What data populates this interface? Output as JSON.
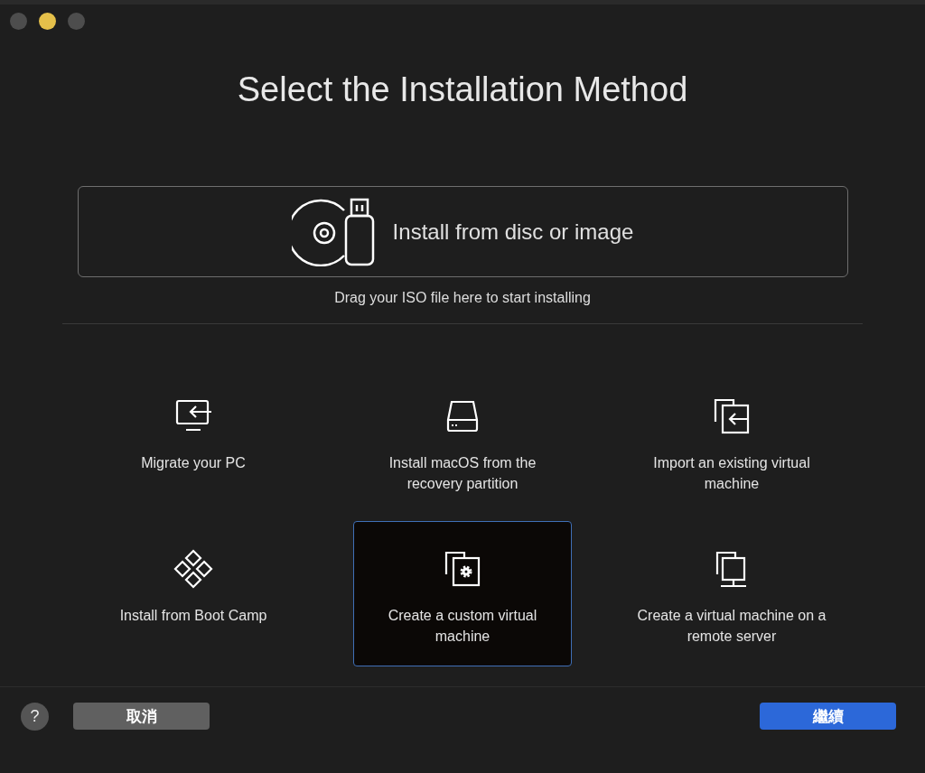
{
  "window": {
    "traffic_lights": [
      {
        "color": "#4d4d4d"
      },
      {
        "color": "#e5c04a"
      },
      {
        "color": "#4d4d4d"
      }
    ]
  },
  "title": "Select the Installation Method",
  "disc_option": {
    "label": "Install from disc or image",
    "hint": "Drag your ISO file here to start installing"
  },
  "options": [
    {
      "kind": "migrate",
      "label": "Migrate your PC",
      "selected": false
    },
    {
      "kind": "recovery",
      "label": "Install macOS from the recovery partition",
      "selected": false
    },
    {
      "kind": "import",
      "label": "Import an existing virtual machine",
      "selected": false
    },
    {
      "kind": "bootcamp",
      "label": "Install from Boot Camp",
      "selected": false
    },
    {
      "kind": "custom",
      "label": "Create a custom virtual machine",
      "selected": true
    },
    {
      "kind": "remote",
      "label": "Create a virtual machine on a remote server",
      "selected": false
    }
  ],
  "footer": {
    "help": "?",
    "cancel": "取消",
    "continue": "繼續"
  }
}
